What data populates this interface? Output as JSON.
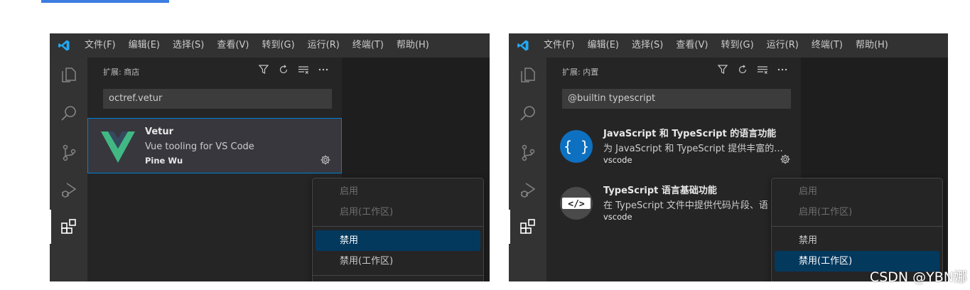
{
  "menu": [
    "文件(F)",
    "编辑(E)",
    "选择(S)",
    "查看(V)",
    "转到(G)",
    "运行(R)",
    "终端(T)",
    "帮助(H)"
  ],
  "left": {
    "sidebar_title": "扩展: 商店",
    "search_value": "octref.vetur",
    "ext": {
      "name": "Vetur",
      "description": "Vue tooling for VS Code",
      "publisher": "Pine Wu"
    },
    "context_menu": {
      "enable": "启用",
      "enable_workspace": "启用(工作区)",
      "disable": "禁用",
      "disable_workspace": "禁用(工作区)"
    }
  },
  "right": {
    "sidebar_title": "扩展: 内置",
    "search_value": "@builtin typescript",
    "ext1": {
      "name": "JavaScript 和 TypeScript 的语言功能",
      "description": "为 JavaScript 和 TypeScript 提供丰富的...",
      "publisher": "vscode"
    },
    "ext2": {
      "name": "TypeScript 语言基础功能",
      "description": "在 TypeScript 文件中提供代码片段、语",
      "publisher": "vscode"
    },
    "context_menu": {
      "enable": "启用",
      "enable_workspace": "启用(工作区)",
      "disable": "禁用",
      "disable_workspace": "禁用(工作区)"
    }
  },
  "watermark": "CSDN @YBN娜",
  "colors": {
    "accent": "#007fd4",
    "menu_highlight": "#04395e",
    "vscode_blue": "#23a9f2",
    "vue_green": "#41b883",
    "vue_dark": "#35495e"
  }
}
